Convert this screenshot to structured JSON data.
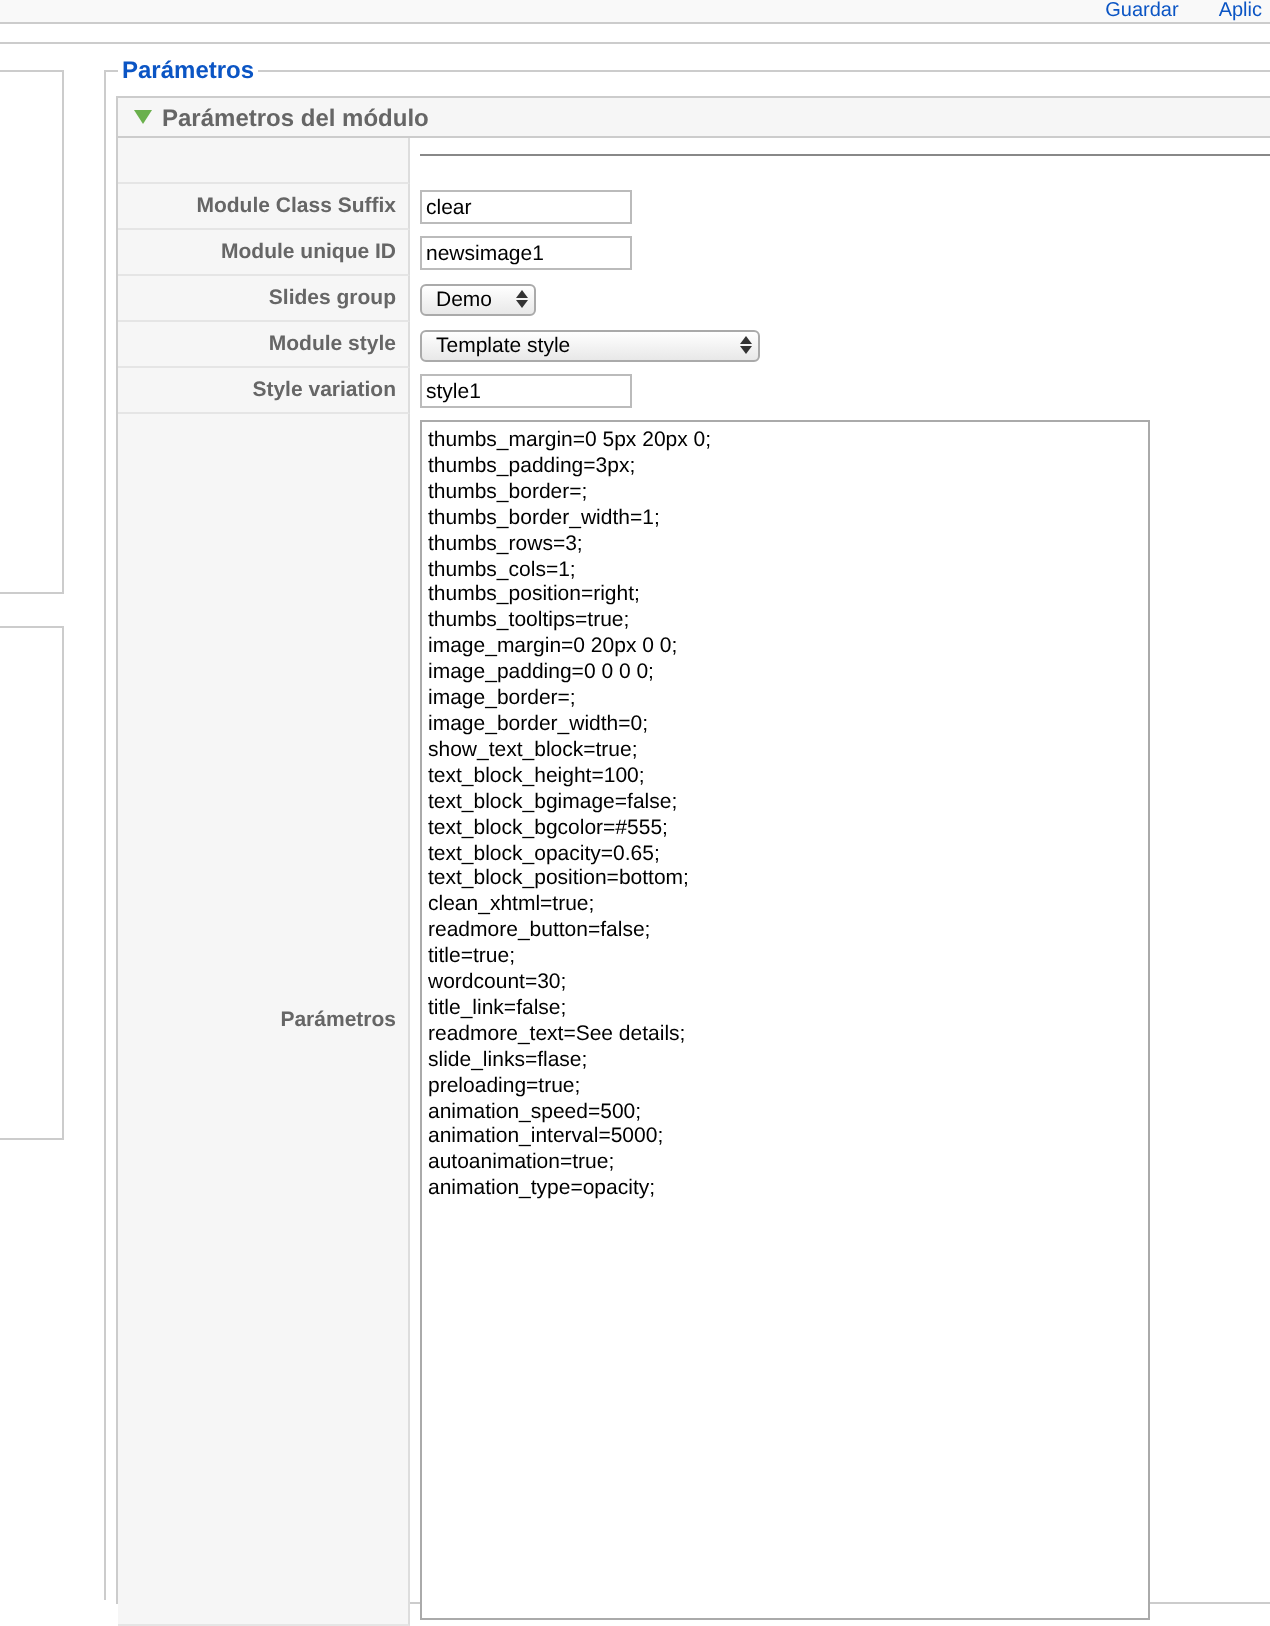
{
  "toolbar": {
    "links": [
      "Guardar",
      "Aplic"
    ]
  },
  "fieldset": {
    "legend": "Parámetros"
  },
  "panel": {
    "title": "Parámetros del módulo",
    "expanded": true
  },
  "rows": [
    {
      "kind": "text",
      "label": "Module Class Suffix",
      "value": "clear"
    },
    {
      "kind": "text",
      "label": "Module unique ID",
      "value": "newsimage1"
    },
    {
      "kind": "select",
      "label": "Slides group",
      "value": "Demo",
      "wide": false
    },
    {
      "kind": "select",
      "label": "Module style",
      "value": "Template style",
      "wide": true
    },
    {
      "kind": "text",
      "label": "Style variation",
      "value": "style1"
    },
    {
      "kind": "textarea",
      "label": "Parámetros",
      "value": "thumbs_margin=0 5px 20px 0;\nthumbs_padding=3px;\nthumbs_border=;\nthumbs_border_width=1;\nthumbs_rows=3;\nthumbs_cols=1;\nthumbs_position=right;\nthumbs_tooltips=true;\nimage_margin=0 20px 0 0;\nimage_padding=0 0 0 0;\nimage_border=;\nimage_border_width=0;\nshow_text_block=true;\ntext_block_height=100;\ntext_block_bgimage=false;\ntext_block_bgcolor=#555;\ntext_block_opacity=0.65;\ntext_block_position=bottom;\nclean_xhtml=true;\nreadmore_button=false;\ntitle=true;\nwordcount=30;\ntitle_link=false;\nreadmore_text=See details;\nslide_links=flase;\npreloading=true;\nanimation_speed=500;\nanimation_interval=5000;\nautoanimation=true;\nanimation_type=opacity;"
    }
  ]
}
